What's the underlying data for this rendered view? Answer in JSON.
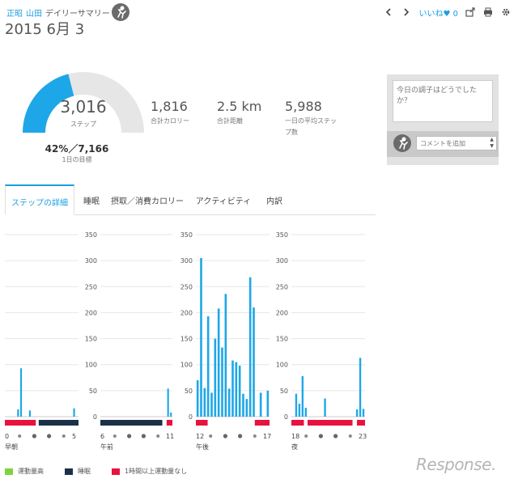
{
  "header": {
    "breadcrumb": [
      "正昭",
      "山田",
      "デイリーサマリー"
    ],
    "like_label": "いいね",
    "like_count": "0",
    "icons": [
      "chevron-left-icon",
      "chevron-right-icon",
      "heart-icon",
      "share-icon",
      "print-icon",
      "gear-icon"
    ]
  },
  "date_label": "2015 6月 3",
  "summary": {
    "steps_value": "3,016",
    "steps_label": "ステップ",
    "goal_text": "42%／7,166",
    "goal_label": "1日の目標",
    "goal_fraction": 0.42,
    "calories_value": "1,816",
    "calories_label": "合計カロリー",
    "distance_value": "2.5 km",
    "distance_label": "合計距離",
    "avg_steps_value": "5,988",
    "avg_steps_label_1": "一日の平均ステッ",
    "avg_steps_label_2": "プ数"
  },
  "mood": {
    "placeholder": "今日の調子はどうでしたか？",
    "comment_placeholder": "コメントを追加"
  },
  "tabs": [
    "ステップの詳細",
    "睡眠",
    "摂取／消費カロリー",
    "アクティビティ",
    "内訳"
  ],
  "chart_data": {
    "type": "bar",
    "ylim": [
      0,
      350
    ],
    "yticks": [
      0,
      50,
      100,
      150,
      200,
      250,
      300,
      350
    ],
    "panels": [
      {
        "name": "早朝",
        "start_label": "0",
        "end_label": "5",
        "values": [
          0,
          0,
          0,
          0,
          14,
          93,
          0,
          0,
          12,
          0,
          0,
          0,
          0,
          0,
          0,
          0,
          0,
          0,
          0,
          0,
          0,
          0,
          0,
          16,
          0
        ],
        "bands": [
          {
            "type": "inactive",
            "from": 0,
            "to": 0.42
          },
          {
            "type": "sleep",
            "from": 0.46,
            "to": 1
          }
        ]
      },
      {
        "name": "午前",
        "start_label": "6",
        "end_label": "11",
        "values": [
          0,
          0,
          0,
          0,
          0,
          0,
          0,
          0,
          0,
          0,
          0,
          0,
          0,
          0,
          0,
          0,
          0,
          0,
          0,
          0,
          0,
          0,
          0,
          54,
          8
        ],
        "bands": [
          {
            "type": "sleep",
            "from": 0,
            "to": 0.86
          },
          {
            "type": "inactive",
            "from": 0.92,
            "to": 1
          }
        ]
      },
      {
        "name": "午後",
        "start_label": "12",
        "end_label": "17",
        "values": [
          70,
          305,
          55,
          193,
          46,
          150,
          208,
          133,
          236,
          54,
          108,
          105,
          98,
          44,
          34,
          268,
          210,
          0,
          46,
          0,
          50
        ],
        "bands": [
          {
            "type": "inactive",
            "from": 0,
            "to": 0.16
          },
          {
            "type": "inactive",
            "from": 0.8,
            "to": 1
          }
        ]
      },
      {
        "name": "夜",
        "start_label": "18",
        "end_label": "23",
        "values": [
          0,
          44,
          25,
          78,
          17,
          0,
          0,
          0,
          0,
          0,
          35,
          0,
          0,
          0,
          0,
          0,
          0,
          0,
          0,
          0,
          14,
          113,
          15
        ],
        "bands": [
          {
            "type": "inactive",
            "from": 0,
            "to": 0.17
          },
          {
            "type": "inactive",
            "from": 0.22,
            "to": 0.83
          },
          {
            "type": "inactive",
            "from": 0.89,
            "to": 1
          }
        ]
      }
    ],
    "legend": [
      "運動量高",
      "睡眠",
      "1時間以上運動量なし"
    ],
    "colors": {
      "bar": "#1ea7e8",
      "high": "#7ed43a",
      "sleep": "#1c3148",
      "inactive": "#e8123f",
      "grid": "#e6e6e6"
    }
  },
  "watermark": "Response."
}
